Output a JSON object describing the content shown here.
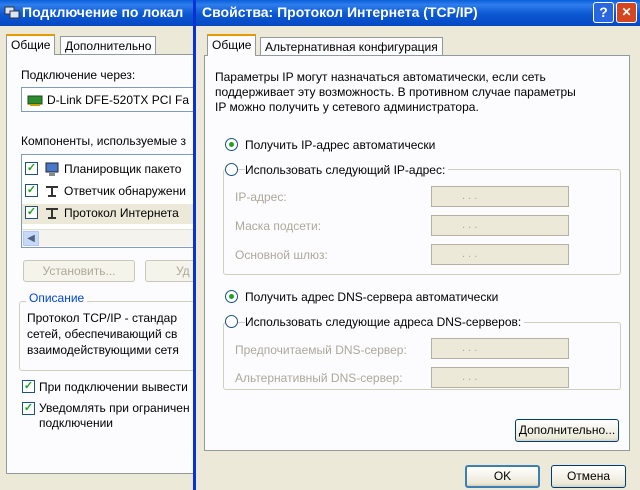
{
  "back_window": {
    "title": "Подключение по локал",
    "tabs": [
      "Общие",
      "Дополнительно"
    ],
    "connect_via_label": "Подключение через:",
    "adapter_name": "D-Link DFE-520TX PCI Fa",
    "components_label": "Компоненты, используемые з",
    "components": [
      "Планировщик пакето",
      "Ответчик обнаружени",
      "Протокол Интернета"
    ],
    "install_label": "Установить...",
    "remove_label": "Уд",
    "description_label": "Описание",
    "description_lines": [
      "Протокол TCP/IP - стандар",
      "сетей, обеспечивающий св",
      "взаимодействующими сетя"
    ],
    "show_icon_label": "При подключении вывести",
    "notify_label_1": "Уведомлять при ограничен",
    "notify_label_2": "подключении"
  },
  "dialog": {
    "title": "Свойства: Протокол Интернета (TCP/IP)",
    "help_glyph": "?",
    "close_glyph": "✕",
    "tabs": [
      "Общие",
      "Альтернативная конфигурация"
    ],
    "intro_lines": [
      "Параметры IP могут назначаться автоматически, если сеть",
      "поддерживает эту возможность. В противном случае параметры",
      "IP можно получить у сетевого администратора."
    ],
    "radio_auto_ip": "Получить IP-адрес автоматически",
    "radio_manual_ip": "Использовать следующий IP-адрес:",
    "ip_label": "IP-адрес:",
    "mask_label": "Маска подсети:",
    "gateway_label": "Основной шлюз:",
    "radio_auto_dns": "Получить адрес DNS-сервера автоматически",
    "radio_manual_dns": "Использовать следующие адреса DNS-серверов:",
    "preferred_dns_label": "Предпочитаемый DNS-сервер:",
    "alternate_dns_label": "Альтернативный DNS-сервер:",
    "ip_dots": ".          .          .",
    "advanced_label": "Дополнительно...",
    "ok_label": "OK",
    "cancel_label": "Отмена",
    "selected_ip_mode": "auto",
    "selected_dns_mode": "auto"
  },
  "colors": {
    "title_blue": "#0b58d2",
    "face": "#ece9d8",
    "radio_dot": "#21a121",
    "tab_highlight": "#e69a00"
  }
}
